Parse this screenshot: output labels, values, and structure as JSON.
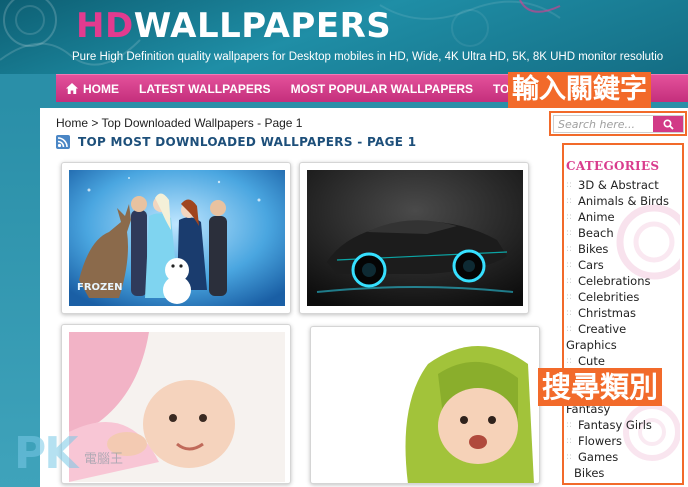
{
  "header": {
    "logo_hd": "HD",
    "logo_rest": "WALLPAPERS",
    "tagline": "Pure High Definition quality wallpapers for Desktop mobiles in HD, Wide, 4K Ultra HD, 5K, 8K UHD monitor resolutio"
  },
  "nav": {
    "home": "HOME",
    "latest": "LATEST WALLPAPERS",
    "popular": "MOST POPULAR WALLPAPERS",
    "partial": "TO"
  },
  "breadcrumb": "Home > Top Downloaded Wallpapers - Page 1",
  "page_title": "TOP MOST DOWNLOADED WALLPAPERS - PAGE 1",
  "search": {
    "placeholder": "Search here..."
  },
  "sidebar": {
    "heading": "CATEGORIES",
    "items": [
      "3D & Abstract",
      "Animals & Birds",
      "Anime",
      "Beach",
      "Bikes",
      "Cars",
      "Celebrations",
      "Celebrities",
      "Christmas",
      "Creative",
      "Graphics",
      "Cute",
      "Fantasy",
      "Fantasy Girls",
      "Flowers",
      "Games",
      "Bikes"
    ]
  },
  "thumbs": {
    "frozen_caption": "FROZEN"
  },
  "annotations": {
    "search_label": "輸入關鍵字",
    "category_label": "搜尋類別"
  },
  "watermark": {
    "brand": "PK",
    "sub": "電腦王"
  },
  "colors": {
    "accent_pink": "#d23a87",
    "nav_pink": "#e4519b",
    "header_teal": "#1f8ea6",
    "callout_orange": "#f26a2a",
    "title_blue": "#1d4f7a"
  }
}
